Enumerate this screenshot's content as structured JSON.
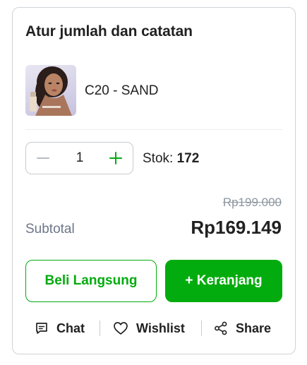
{
  "panel": {
    "title": "Atur jumlah dan catatan"
  },
  "product": {
    "variant": "C20 - SAND",
    "image_icon": "product-thumbnail"
  },
  "quantity": {
    "value": "1",
    "stock_label": "Stok:",
    "stock_value": "172"
  },
  "pricing": {
    "original_price": "Rp199.000",
    "subtotal_label": "Subtotal",
    "subtotal_price": "Rp169.149"
  },
  "buttons": {
    "buy_now": "Beli Langsung",
    "add_to_cart": "+ Keranjang"
  },
  "actions": {
    "chat": "Chat",
    "wishlist": "Wishlist",
    "share": "Share"
  },
  "colors": {
    "accent": "#03ac0e",
    "text": "#212121",
    "muted": "#6d7588",
    "strikethrough": "#8d96a0",
    "border": "#c6cbd1"
  }
}
